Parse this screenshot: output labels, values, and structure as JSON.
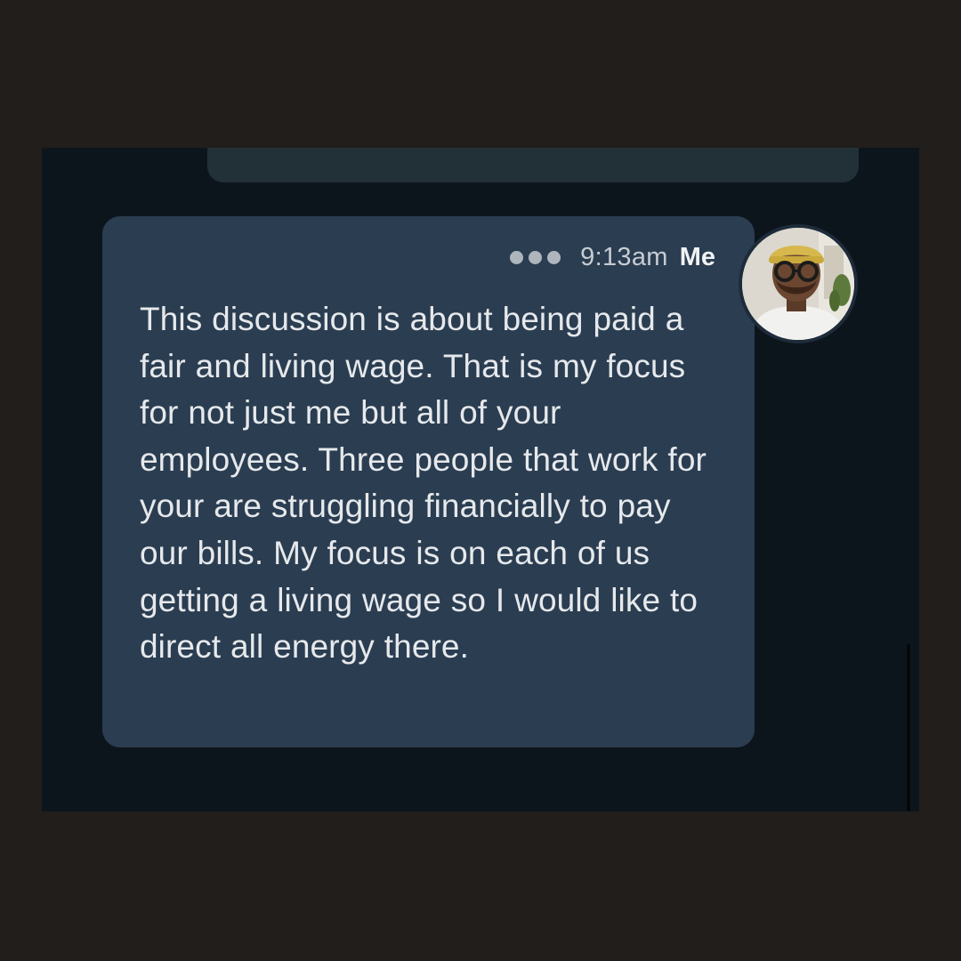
{
  "chat": {
    "messages": [
      {
        "time": "9:13am",
        "sender": "Me",
        "text": "This discussion is about being paid a fair and living wage. That is my focus for not just me but all of your employees. Three people that work for your are struggling financially to pay our bills. My focus is on each of us getting a living wage so I would like to direct all energy there."
      }
    ]
  },
  "icons": {
    "more": "more-horizontal-icon",
    "avatar": "user-avatar-photo"
  },
  "colors": {
    "background": "#211e1b",
    "thread_background": "#0d151c",
    "bubble": "#2b3d51",
    "previous_bubble": "#223038",
    "text": "#e6e9ec",
    "meta_text": "#c6ccd2"
  }
}
